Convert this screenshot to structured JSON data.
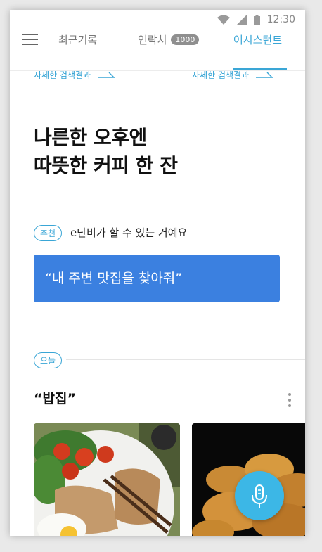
{
  "status_bar": {
    "time": "12:30"
  },
  "tabs": [
    {
      "label": "최근기록"
    },
    {
      "label": "연락처",
      "badge": "1000"
    },
    {
      "label": "어시스턴트"
    }
  ],
  "detail_links": [
    {
      "label": "자세한 검색결과"
    },
    {
      "label": "자세한 검색결과"
    }
  ],
  "headline": {
    "line1": "나른한 오후엔",
    "line2": "따뜻한 커피 한 잔"
  },
  "recommendation": {
    "chip": "추천",
    "text": "e단비가 할 수 있는 거예요"
  },
  "suggestion_button": {
    "label": "“내 주변 맛집을 찾아줘”"
  },
  "today": {
    "chip": "오늘"
  },
  "section": {
    "title": "“밥집”"
  },
  "colors": {
    "accent": "#3aa6d6",
    "primary_button": "#3b80e0",
    "mic": "#3cb7e6"
  },
  "icons": [
    "wifi-icon",
    "signal-icon",
    "battery-icon",
    "menu-icon",
    "arrow-right-icon",
    "more-vert-icon",
    "mic-icon"
  ]
}
